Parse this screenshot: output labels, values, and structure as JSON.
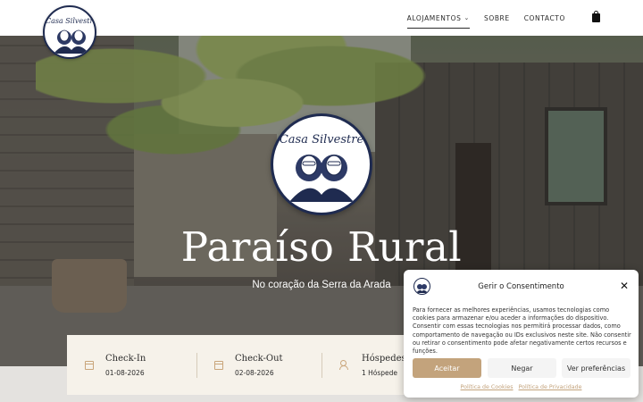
{
  "brand": {
    "name": "Casa Silvestre"
  },
  "nav": {
    "items": [
      {
        "label": "ALOJAMENTOS"
      },
      {
        "label": "SOBRE"
      },
      {
        "label": "CONTACTO"
      }
    ],
    "cart_icon": "shopping-bag-icon"
  },
  "hero": {
    "title": "Paraíso Rural",
    "subtitle": "No coração da Serra da Arada"
  },
  "booking": {
    "checkin_label": "Check-In",
    "checkin_value": "01-08-2026",
    "checkout_label": "Check-Out",
    "checkout_value": "02-08-2026",
    "guests_label": "Hóspedes",
    "guests_value": "1 Hóspede"
  },
  "cookie": {
    "title": "Gerir o Consentimento",
    "text": "Para fornecer as melhores experiências, usamos tecnologias como cookies para armazenar e/ou aceder a informações do dispositivo. Consentir com essas tecnologias nos permitirá processar dados, como comportamento de navegação ou IDs exclusivos neste site. Não consentir ou retirar o consentimento pode afetar negativamente certos recursos e funções.",
    "accept_label": "Aceitar",
    "deny_label": "Negar",
    "prefs_label": "Ver preferências",
    "cookie_policy_link": "Política de Cookies",
    "privacy_policy_link": "Política de Privacidade"
  },
  "colors": {
    "accent": "#c3a37c",
    "navy": "#1f2b50"
  }
}
